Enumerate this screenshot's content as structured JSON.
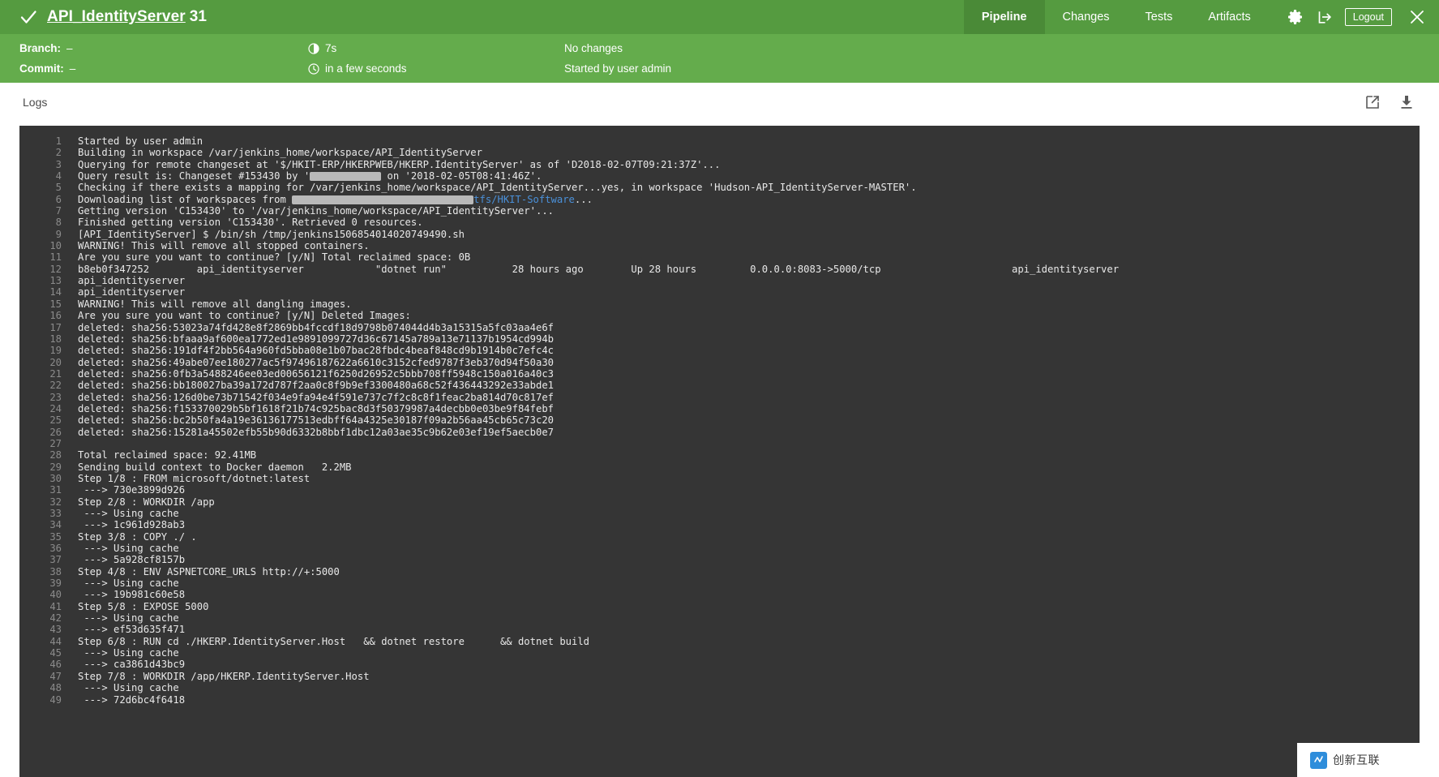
{
  "header": {
    "status_icon": "check-icon",
    "job_name": "API_IdentityServer",
    "build_number": "31",
    "nav": [
      {
        "label": "Pipeline",
        "active": true
      },
      {
        "label": "Changes",
        "active": false
      },
      {
        "label": "Tests",
        "active": false
      },
      {
        "label": "Artifacts",
        "active": false
      }
    ],
    "actions": {
      "settings_icon": "gear-icon",
      "rerun_icon": "replay-arrow-icon",
      "logout_label": "Logout",
      "close_icon": "close-icon"
    },
    "info": {
      "branch_label": "Branch:",
      "branch_value": "–",
      "commit_label": "Commit:",
      "commit_value": "–",
      "duration_icon": "half-clock-icon",
      "duration_value": "7s",
      "time_icon": "clock-icon",
      "time_value": "in a few seconds",
      "changes_value": "No changes",
      "cause_value": "Started by user admin"
    },
    "colors": {
      "header_top": "#559b40",
      "header_info": "#64ac4c",
      "active_tab": "#4a8a37",
      "console_bg": "#353535"
    }
  },
  "logs": {
    "title": "Logs",
    "open_external_icon": "external-link-icon",
    "download_icon": "download-icon"
  },
  "console": {
    "lines": [
      {
        "n": "1",
        "text": "Started by user admin"
      },
      {
        "n": "2",
        "text": "Building in workspace /var/jenkins_home/workspace/API_IdentityServer"
      },
      {
        "n": "3",
        "text": "Querying for remote changeset at '$/HKIT-ERP/HKERPWEB/HKERP.IdentityServer' as of 'D2018-02-07T09:21:37Z'..."
      },
      {
        "n": "4",
        "pre": "Query result is: Changeset #153430 by '",
        "redact": 88,
        "post": " on '2018-02-05T08:41:46Z'."
      },
      {
        "n": "5",
        "text": "Checking if there exists a mapping for /var/jenkins_home/workspace/API_IdentityServer...yes, in workspace 'Hudson-API_IdentityServer-MASTER'."
      },
      {
        "n": "6",
        "pre": "Downloading list of workspaces from ",
        "redact": 224,
        "link": "tfs/HKIT-Software",
        "post": "..."
      },
      {
        "n": "7",
        "text": "Getting version 'C153430' to '/var/jenkins_home/workspace/API_IdentityServer'..."
      },
      {
        "n": "8",
        "text": "Finished getting version 'C153430'. Retrieved 0 resources."
      },
      {
        "n": "9",
        "text": "[API_IdentityServer] $ /bin/sh /tmp/jenkins1506854014020749490.sh"
      },
      {
        "n": "10",
        "text": "WARNING! This will remove all stopped containers."
      },
      {
        "n": "11",
        "text": "Are you sure you want to continue? [y/N] Total reclaimed space: 0B"
      },
      {
        "n": "12",
        "text": "b8eb0f347252        api_identityserver            \"dotnet run\"           28 hours ago        Up 28 hours         0.0.0.0:8083->5000/tcp                      api_identityserver"
      },
      {
        "n": "13",
        "text": "api_identityserver"
      },
      {
        "n": "14",
        "text": "api_identityserver"
      },
      {
        "n": "15",
        "text": "WARNING! This will remove all dangling images."
      },
      {
        "n": "16",
        "text": "Are you sure you want to continue? [y/N] Deleted Images:"
      },
      {
        "n": "17",
        "text": "deleted: sha256:53023a74fd428e8f2869bb4fccdf18d9798b074044d4b3a15315a5fc03aa4e6f"
      },
      {
        "n": "18",
        "text": "deleted: sha256:bfaaa9af600ea1772ed1e9891099727d36c67145a789a13e71137b1954cd994b"
      },
      {
        "n": "19",
        "text": "deleted: sha256:191df4f2bb564a960fd5bba08e1b07bac28fbdc4beaf848cd9b1914b0c7efc4c"
      },
      {
        "n": "20",
        "text": "deleted: sha256:49abe07ee180277ac5f97496187622a6610c3152cfed9787f3eb370d94f50a30"
      },
      {
        "n": "21",
        "text": "deleted: sha256:0fb3a5488246ee03ed00656121f6250d26952c5bbb708ff5948c150a016a40c3"
      },
      {
        "n": "22",
        "text": "deleted: sha256:bb180027ba39a172d787f2aa0c8f9b9ef3300480a68c52f436443292e33abde1"
      },
      {
        "n": "23",
        "text": "deleted: sha256:126d0be73b71542f034e9fa94e4f591e737c7f2c8c8f1feac2ba814d70c817ef"
      },
      {
        "n": "24",
        "text": "deleted: sha256:f153370029b5bf1618f21b74c925bac8d3f50379987a4decbb0e03be9f84febf"
      },
      {
        "n": "25",
        "text": "deleted: sha256:bc2b50fa4a19e36136177513edbff64a4325e30187f09a2b56aa45cb65c73c20"
      },
      {
        "n": "26",
        "text": "deleted: sha256:15281a45502efb55b90d6332b8bbf1dbc12a03ae35c9b62e03ef19ef5aecb0e7"
      },
      {
        "n": "27",
        "text": ""
      },
      {
        "n": "28",
        "text": "Total reclaimed space: 92.41MB"
      },
      {
        "n": "29",
        "text": "Sending build context to Docker daemon   2.2MB"
      },
      {
        "n": "30",
        "text": "Step 1/8 : FROM microsoft/dotnet:latest"
      },
      {
        "n": "31",
        "text": " ---> 730e3899d926"
      },
      {
        "n": "32",
        "text": "Step 2/8 : WORKDIR /app"
      },
      {
        "n": "33",
        "text": " ---> Using cache"
      },
      {
        "n": "34",
        "text": " ---> 1c961d928ab3"
      },
      {
        "n": "35",
        "text": "Step 3/8 : COPY ./ ."
      },
      {
        "n": "36",
        "text": " ---> Using cache"
      },
      {
        "n": "37",
        "text": " ---> 5a928cf8157b"
      },
      {
        "n": "38",
        "text": "Step 4/8 : ENV ASPNETCORE_URLS http://+:5000"
      },
      {
        "n": "39",
        "text": " ---> Using cache"
      },
      {
        "n": "40",
        "text": " ---> 19b981c60e58"
      },
      {
        "n": "41",
        "text": "Step 5/8 : EXPOSE 5000"
      },
      {
        "n": "42",
        "text": " ---> Using cache"
      },
      {
        "n": "43",
        "text": " ---> ef53d635f471"
      },
      {
        "n": "44",
        "text": "Step 6/8 : RUN cd ./HKERP.IdentityServer.Host   && dotnet restore      && dotnet build"
      },
      {
        "n": "45",
        "text": " ---> Using cache"
      },
      {
        "n": "46",
        "text": " ---> ca3861d43bc9"
      },
      {
        "n": "47",
        "text": "Step 7/8 : WORKDIR /app/HKERP.IdentityServer.Host"
      },
      {
        "n": "48",
        "text": " ---> Using cache"
      },
      {
        "n": "49",
        "text": " ---> 72d6bc4f6418"
      }
    ]
  },
  "watermark": {
    "text": "创新互联"
  }
}
